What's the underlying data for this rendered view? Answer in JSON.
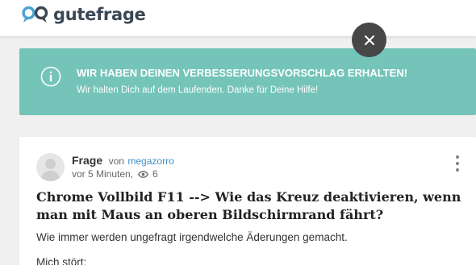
{
  "header": {
    "logo_text": "gutefrage"
  },
  "banner": {
    "title": "WIR HABEN DEINEN VERBESSERUNGSVORSCHLAG ERHALTEN!",
    "text": "Wir halten Dich auf dem Laufenden. Danke für Deine Hilfe!",
    "icon": "info-icon",
    "color": "#75c4b9"
  },
  "question": {
    "type_label": "Frage",
    "by_label": "von",
    "author": "megazorro",
    "time": "vor 5 Minuten,",
    "views": "6",
    "title": "Chrome Vollbild F11 --> Wie das Kreuz deaktivieren, wenn man mit Maus an oberen Bildschirmrand fährt?",
    "body_line1": "Wie immer werden ungefragt irgendwelche Äderungen gemacht.",
    "body_line2": "Mich stört:"
  },
  "colors": {
    "brand": "#3f8fc6",
    "banner": "#75c4b9",
    "close_button": "#474747"
  }
}
